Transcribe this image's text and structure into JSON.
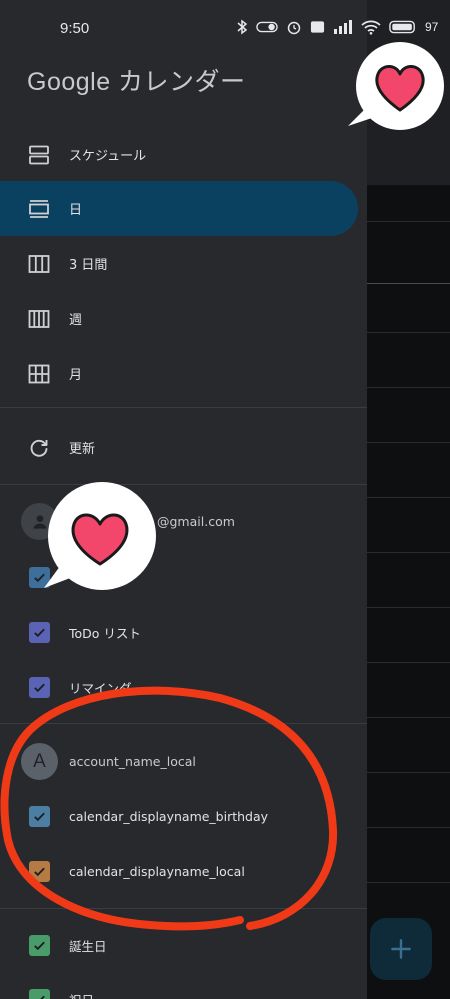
{
  "status_bar": {
    "time": "9:50",
    "battery": "97"
  },
  "app": {
    "title": "Google カレンダー"
  },
  "nav": {
    "items": [
      {
        "label": "スケジュール",
        "icon": "schedule-icon"
      },
      {
        "label": "日",
        "icon": "day-icon",
        "active": true
      },
      {
        "label": "3 日間",
        "icon": "three-day-icon"
      },
      {
        "label": "週",
        "icon": "week-icon"
      },
      {
        "label": "月",
        "icon": "month-icon"
      }
    ],
    "refresh_label": "更新"
  },
  "account": {
    "email_suffix": "@gmail.com",
    "calendars": [
      {
        "label": "",
        "color": "#3e6f9b"
      },
      {
        "label": "ToDo リスト",
        "color": "#5a63b4"
      },
      {
        "label": "リマインダー",
        "color": "#5a63b4"
      }
    ]
  },
  "local_account": {
    "avatar_letter": "A",
    "name": "account_name_local",
    "calendars": [
      {
        "label": "calendar_displayname_birthday",
        "color": "#4b7ea2"
      },
      {
        "label": "calendar_displayname_local",
        "color": "#b67a44"
      }
    ]
  },
  "other_calendars": [
    {
      "label": "誕生日",
      "color": "#4a9b6a"
    },
    {
      "label": "祝日",
      "color": "#4a9b6a"
    }
  ],
  "colors": {
    "drawer_bg": "#28292d",
    "active_bg": "#0b4160",
    "annotation_red": "#f03a17",
    "heart_pink": "#f2476b"
  }
}
